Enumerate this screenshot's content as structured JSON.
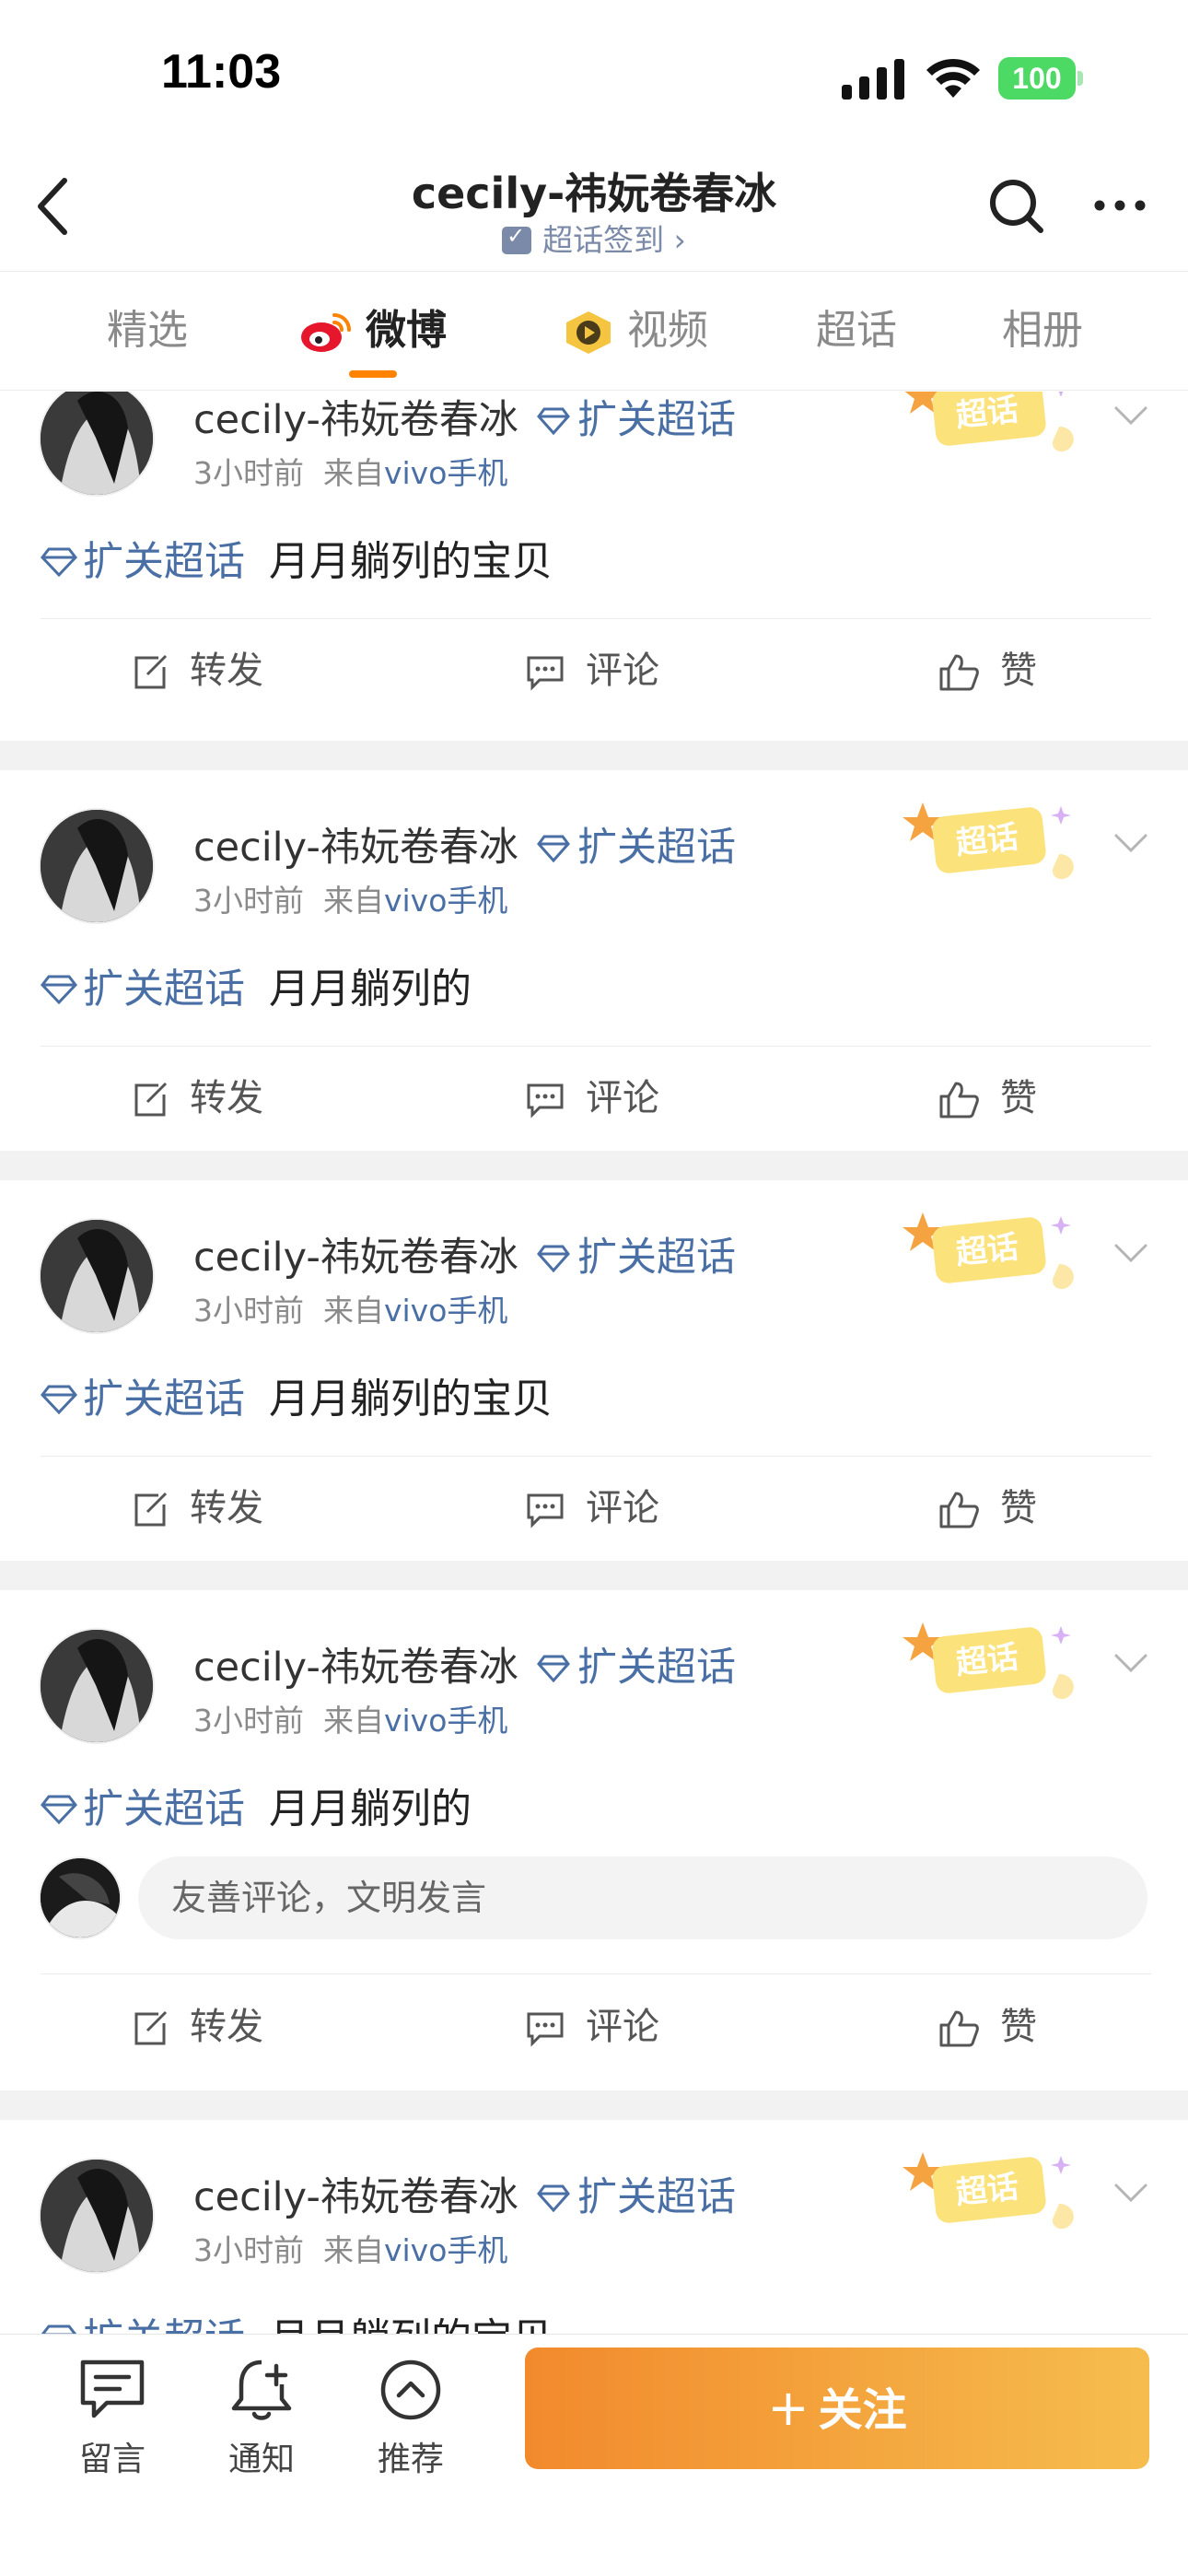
{
  "status": {
    "time": "11:03",
    "battery": "100"
  },
  "nav": {
    "title": "cecily-祎妧卷春冰",
    "subtitle": "超话签到 ›"
  },
  "tabs": [
    {
      "label": "精选",
      "active": false
    },
    {
      "label": "微博",
      "active": true
    },
    {
      "label": "视频",
      "active": false
    },
    {
      "label": "超话",
      "active": false
    },
    {
      "label": "相册",
      "active": false
    }
  ],
  "posts": [
    {
      "username": "cecily-祎妧卷春冰",
      "badge": "扩关超话",
      "time": "3小时前",
      "from_label": "来自",
      "source": "vivo手机",
      "stamp": "超话",
      "tag": "扩关超话",
      "text": "月月躺列的宝贝",
      "repost": "转发",
      "comment": "评论",
      "like": "赞"
    },
    {
      "username": "cecily-祎妧卷春冰",
      "badge": "扩关超话",
      "time": "3小时前",
      "from_label": "来自",
      "source": "vivo手机",
      "stamp": "超话",
      "tag": "扩关超话",
      "text": "月月躺列的",
      "repost": "转发",
      "comment": "评论",
      "like": "赞"
    },
    {
      "username": "cecily-祎妧卷春冰",
      "badge": "扩关超话",
      "time": "3小时前",
      "from_label": "来自",
      "source": "vivo手机",
      "stamp": "超话",
      "tag": "扩关超话",
      "text": "月月躺列的宝贝",
      "repost": "转发",
      "comment": "评论",
      "like": "赞"
    },
    {
      "username": "cecily-祎妧卷春冰",
      "badge": "扩关超话",
      "time": "3小时前",
      "from_label": "来自",
      "source": "vivo手机",
      "stamp": "超话",
      "tag": "扩关超话",
      "text": "月月躺列的",
      "comment_placeholder": "友善评论，文明发言",
      "repost": "转发",
      "comment": "评论",
      "like": "赞"
    },
    {
      "username": "cecily-祎妧卷春冰",
      "badge": "扩关超话",
      "time": "3小时前",
      "from_label": "来自",
      "source": "vivo手机",
      "stamp": "超话",
      "tag": "扩关超话",
      "text": "月月躺列的宝贝"
    }
  ],
  "bottom_bar": {
    "items": [
      {
        "label": "留言",
        "icon": "message-icon"
      },
      {
        "label": "通知",
        "icon": "bell-plus-icon"
      },
      {
        "label": "推荐",
        "icon": "chevron-up-circle-icon"
      }
    ],
    "follow_plus": "+",
    "follow_label": "关注"
  },
  "colors": {
    "accent": "#ff8200",
    "link": "#4a6fa5",
    "follow_gradient": [
      "#f28a2c",
      "#f6bd4e"
    ]
  }
}
